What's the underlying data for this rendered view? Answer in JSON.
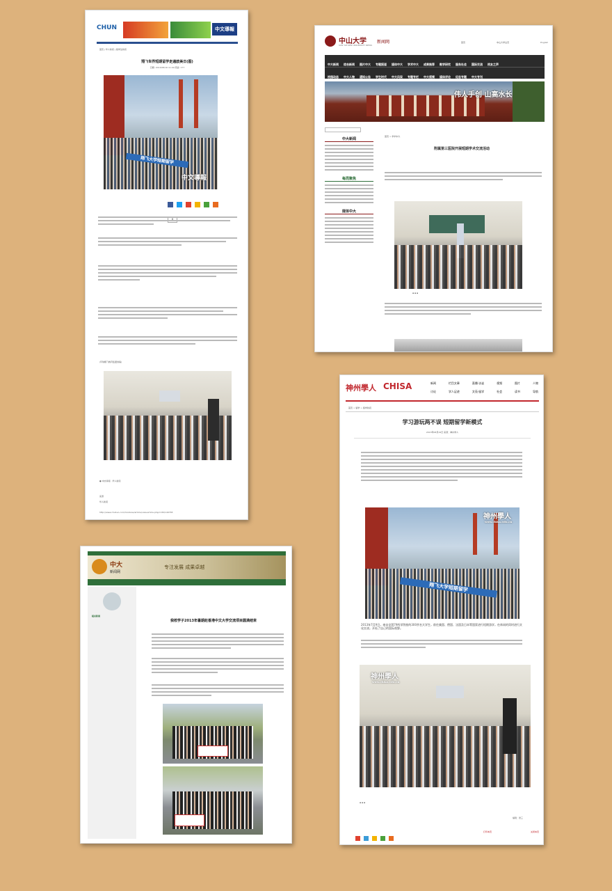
{
  "colors": {
    "background": "#ddb27c",
    "chisa_red": "#c1272d",
    "sysu_maroon": "#8b1a1a",
    "cuhk_green": "#2f6f3a"
  },
  "card1": {
    "logo": "CHUN",
    "banner_text": "中文導報",
    "breadcrumb": "首页 | 华人新闻 | 留学生新闻",
    "title": "翔飞世界短期留学走遍欧美日(图)",
    "meta": "日期: 2013/08/16 11:02  阅读: 177",
    "watermark": "中文導報",
    "share_count": "0",
    "caption": "(环球翔飞教育集团供稿)",
    "footer_source": "来源",
    "footer_tag": "华人新闻",
    "footer_url": "http://www.chubun.com/modules/article/view.article.php/c130/149765"
  },
  "card2": {
    "logo_cn": "中山大学",
    "logo_sub": "新闻网",
    "logo_en": "SUN YAT-SEN UNIVERSITY NEWS",
    "top_links": [
      "首页",
      "中山大学主页",
      "English"
    ],
    "nav_row1": [
      "中大新闻",
      "综合新闻",
      "图片中大",
      "专题报道",
      "媒体中大",
      "学术中大",
      "成果推荐",
      "教学研究",
      "服务社会",
      "国际交流",
      "校友之声"
    ],
    "nav_row2": [
      "校园动态",
      "中大人物",
      "通知公告",
      "学生时代",
      "中大风采",
      "专题专栏",
      "中大视频",
      "媒体评论",
      "纪念专题",
      "中大专刊"
    ],
    "hero_text": "伟人手创 山高水长",
    "sidebar_news": "中大新闻",
    "sidebar_focus": "每周聚焦",
    "sidebar_media": "媒体中大",
    "breadcrumb": "首页 > 学术中大",
    "article_title": "附属第三医院开展短期学术交流活动"
  },
  "card3": {
    "logo_cn": "中大",
    "logo_sub": "新闻网",
    "header_text": "专注发展 成果卓越",
    "sidebar_item": "相关新闻",
    "article_title": "我校学子2013年暑期赴香港中文大学交流项目圆满结束"
  },
  "card4": {
    "logo_cn": "神州學人",
    "logo_en": "CHISA",
    "nav_row1": [
      "新闻",
      "栏目文章",
      "直播·访谈",
      "视频",
      "图片",
      "人物"
    ],
    "nav_row2": [
      "讨论",
      "学人足迹",
      "文苑·留学",
      "社会",
      "读书",
      "导航"
    ],
    "breadcrumb": "首页 > 留学 > 留学新闻",
    "title": "学习游玩两不误 短期留学新模式",
    "meta": "2013年08月19日  来源：神州学人",
    "watermark": "神州學人",
    "watermark_url": "www.chisa.edu.cn",
    "caption_lines": "2013年7月9日，来自全国79所学院校的300余名大学生，前往美国、德国、法国及日本等国家进行短期游学，在休闲的同时进行文化交流，开拓了自己的国际视野。",
    "editor": "编辑：张三",
    "footer_links": [
      "打印本页",
      "关闭本页"
    ]
  }
}
